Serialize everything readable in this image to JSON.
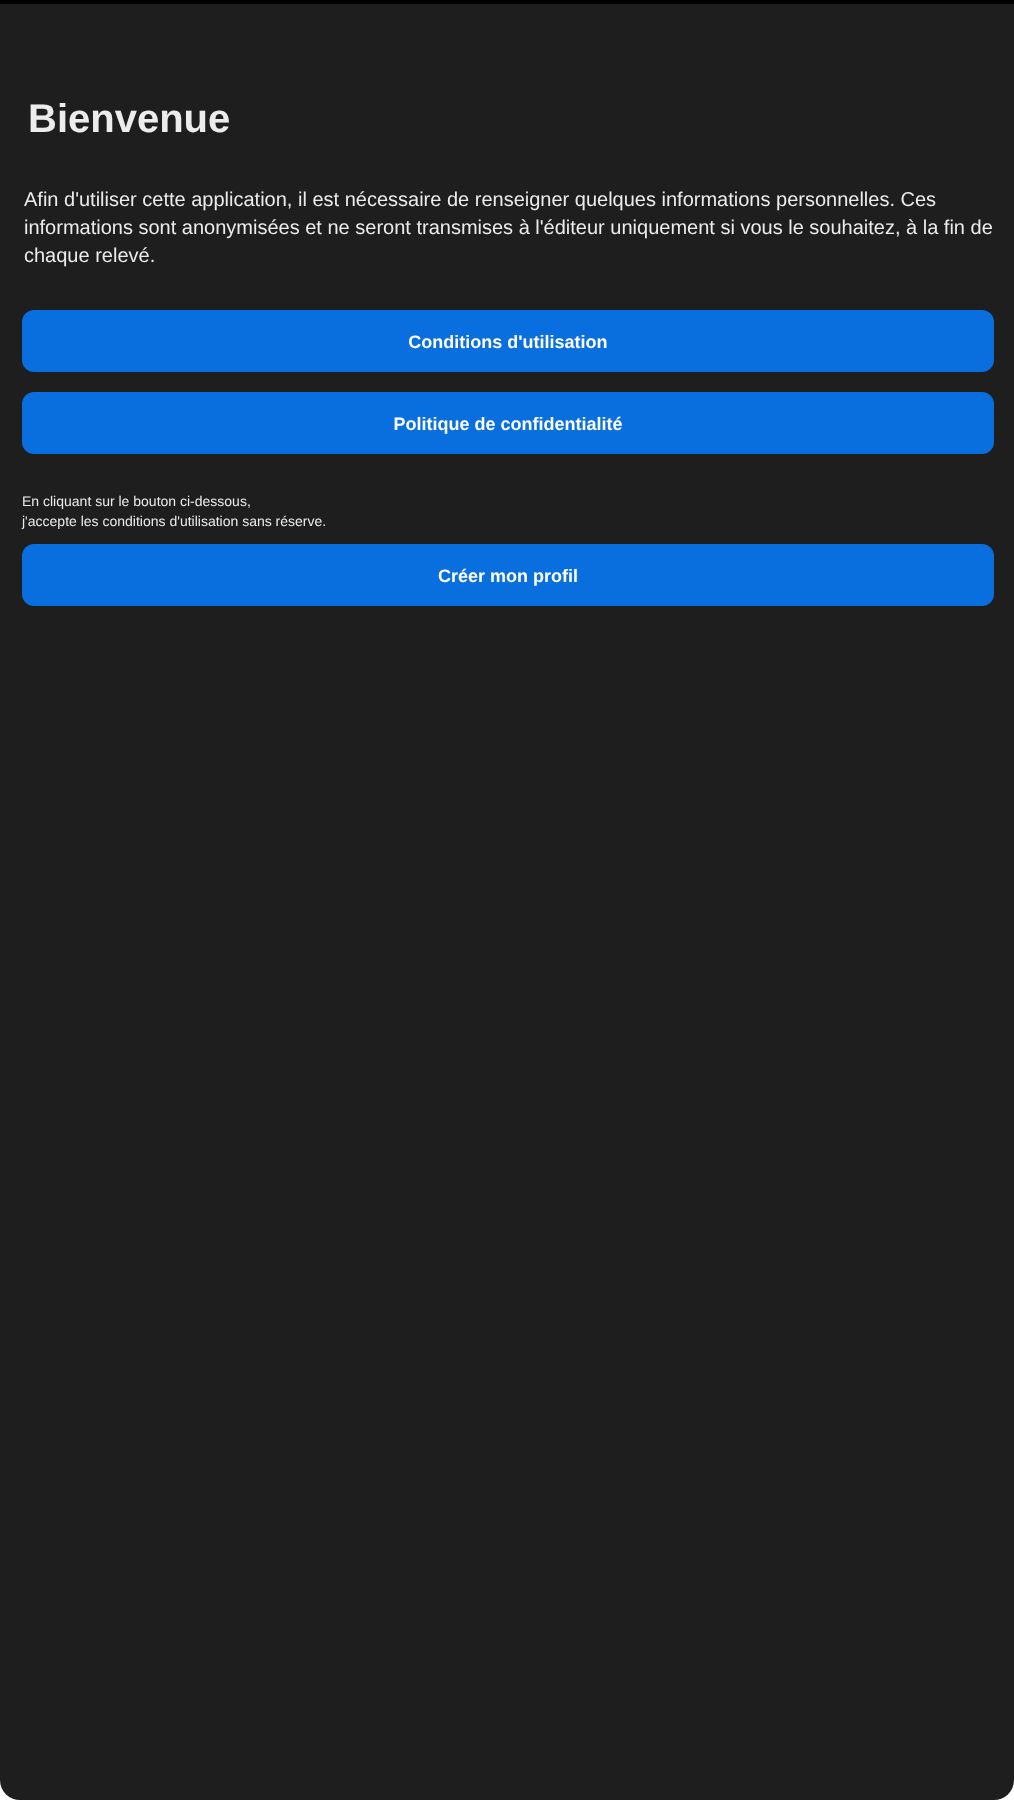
{
  "title": "Bienvenue",
  "intro": "Afin d'utiliser cette application, il est nécessaire de renseigner quelques informations personnelles. Ces informations sont anonymisées et ne seront transmises à l'éditeur uniquement si vous le souhaitez, à la fin de chaque relevé.",
  "links": [
    {
      "label": "Conditions d'utilisation"
    },
    {
      "label": "Politique de confidentialité"
    }
  ],
  "notice": "En cliquant sur le bouton ci-dessous,\nj'accepte les conditions d'utilisation sans réserve.",
  "primary_button": "Créer mon profil"
}
